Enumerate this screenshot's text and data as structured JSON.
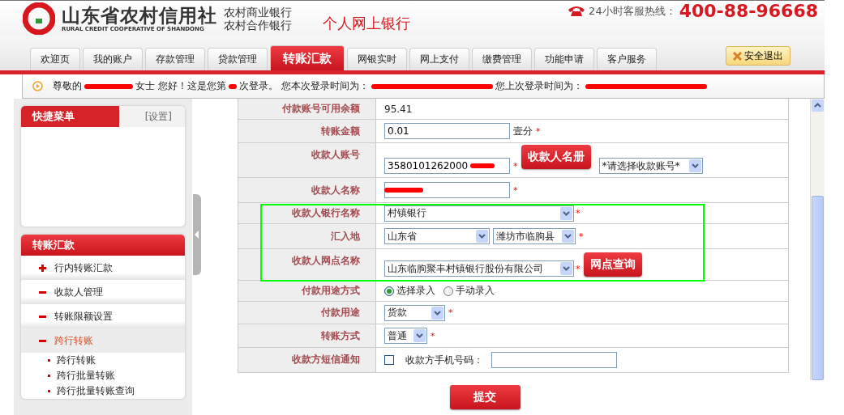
{
  "header": {
    "logo_title": "山东省农村信用社",
    "logo_subtitle": "RURAL CREDIT COOPERATIVE OF SHANDONG",
    "logo_lines": [
      "农村商业银行",
      "农村合作银行"
    ],
    "product_title": "个人网上银行",
    "hotline_label": "24小时客服热线：",
    "hotline_number": "400-88-96668"
  },
  "tabs": [
    {
      "label": "欢迎页",
      "selected": false
    },
    {
      "label": "我的账户",
      "selected": false
    },
    {
      "label": "存款管理",
      "selected": false
    },
    {
      "label": "贷款管理",
      "selected": false
    },
    {
      "label": "转账汇款",
      "selected": true
    },
    {
      "label": "网银实时",
      "selected": false
    },
    {
      "label": "网上支付",
      "selected": false
    },
    {
      "label": "缴费管理",
      "selected": false
    },
    {
      "label": "功能申请",
      "selected": false
    },
    {
      "label": "客户服务",
      "selected": false
    }
  ],
  "logout_button": "安全退出",
  "welcome": [
    {
      "kind": "text",
      "text": "尊敬的"
    },
    {
      "kind": "redacted"
    },
    {
      "kind": "text",
      "text": "女士 您好！这是您第"
    },
    {
      "kind": "redacted"
    },
    {
      "kind": "text",
      "text": "次登录。 您本次登录时间为："
    },
    {
      "kind": "redacted"
    },
    {
      "kind": "text",
      "text": "您上次登录时间为："
    },
    {
      "kind": "redacted"
    }
  ],
  "sidebar": {
    "quick_menu": {
      "title": "快捷菜单",
      "settings_link": "[设置]"
    },
    "transfer_menu": {
      "title": "转账汇款",
      "items": [
        {
          "label": "行内转账汇款",
          "expanded": false,
          "selected": false
        },
        {
          "label": "收款人管理",
          "expanded": true,
          "selected": false
        },
        {
          "label": "转账限额设置",
          "expanded": true,
          "selected": false
        },
        {
          "label": "跨行转账",
          "expanded": true,
          "selected": true,
          "children": [
            {
              "label": "跨行转账"
            },
            {
              "label": "跨行批量转账"
            },
            {
              "label": "跨行批量转账查询"
            }
          ]
        }
      ]
    }
  },
  "form": {
    "rows": [
      {
        "label": "付款账号可用余额",
        "kind": "text",
        "value": "95.41",
        "highlighted": false
      },
      {
        "label": "转账金额",
        "kind": "input",
        "value": "0.01",
        "note": "壹分",
        "mark": "*",
        "redacted": false,
        "highlighted": false
      },
      {
        "label": "收款人账号",
        "kind": "input",
        "value": "3580101262000",
        "redacted": true,
        "mark": "*",
        "button": "收款人名册",
        "select": "*请选择收款账号*",
        "highlighted": false
      },
      {
        "label": "收款人名称",
        "kind": "input",
        "redacted": true,
        "mark": "*",
        "highlighted": false
      },
      {
        "label": "收款人银行名称",
        "kind": "select",
        "value": "村镇银行",
        "mark": "*",
        "highlighted": true
      },
      {
        "label": "汇入地",
        "kind": "location",
        "value": "山东省",
        "second_value": "潍坊市临朐县",
        "mark": "*",
        "highlighted": true
      },
      {
        "label": "收款人网点名称",
        "kind": "select",
        "value": "山东临朐聚丰村镇银行股份有限公司",
        "mark": "*",
        "button": "网点查询",
        "highlighted": true
      },
      {
        "label": "付款用途方式",
        "kind": "radio",
        "options": [
          {
            "label": "选择录入",
            "selected": true
          },
          {
            "label": "手动录入",
            "selected": false
          }
        ],
        "highlighted": false
      },
      {
        "label": "付款用途",
        "kind": "small_select",
        "value": "货款",
        "mark": "*",
        "highlighted": false
      },
      {
        "label": "转账方式",
        "kind": "tiny_select",
        "value": "普通",
        "mark": "*",
        "highlighted": false
      },
      {
        "label": "收款方短信通知",
        "kind": "sms",
        "checked": false,
        "field_label": "收款方手机号码：",
        "highlighted": false
      }
    ],
    "submit": "提交"
  }
}
